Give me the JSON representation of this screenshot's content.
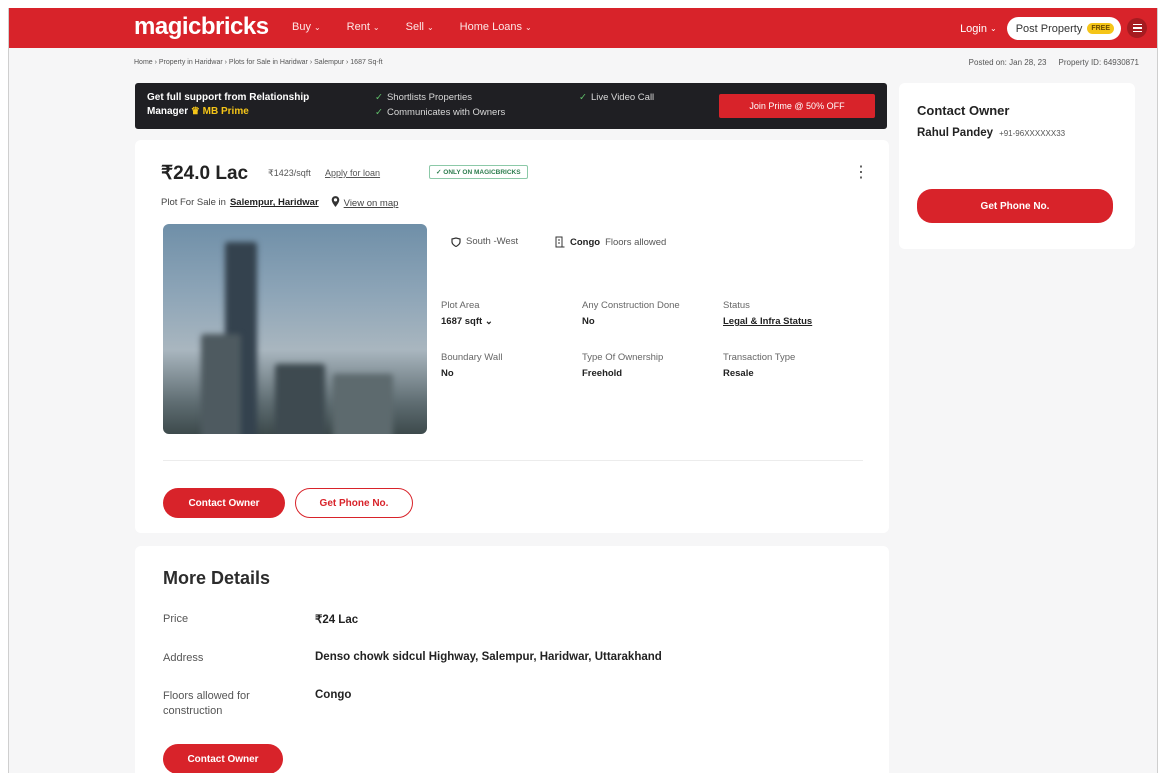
{
  "header": {
    "logo": "magicbricks",
    "nav": [
      {
        "label": "Buy"
      },
      {
        "label": "Rent"
      },
      {
        "label": "Sell"
      },
      {
        "label": "Home Loans"
      }
    ],
    "login_label": "Login",
    "post_property_label": "Post Property",
    "post_property_badge": "FREE",
    "menu_icon": "hamburger-icon"
  },
  "breadcrumb": "Home › Property in Haridwar › Plots for Sale in Haridwar › Salempur › 1687 Sq-ft",
  "posted_on": "Posted on: Jan 28, 23",
  "property_id": "Property ID: 64930871",
  "prime_banner": {
    "title_line1": "Get full support from Relationship",
    "title_line2_prefix": "Manager",
    "title_line2_brand": "MB Prime",
    "features": [
      "Shortlists Properties",
      "Communicates with Owners",
      "Live Video Call"
    ],
    "cta": "Join Prime @ 50% OFF"
  },
  "listing": {
    "price": "₹24.0 Lac",
    "price_per_sqft": "₹1423/sqft",
    "apply_loan": "Apply for loan",
    "only_badge": "ONLY ON MAGICBRICKS",
    "subtitle_prefix": "Plot For Sale in",
    "location": "Salempur, Haridwar",
    "view_map": "View on map",
    "facing": "South -West",
    "floors_value": "Congo",
    "floors_suffix": "Floors allowed",
    "attributes": [
      {
        "label": "Plot Area",
        "value": "1687 sqft"
      },
      {
        "label": "Any Construction Done",
        "value": "No"
      },
      {
        "label": "Status",
        "value": "Legal & Infra Status"
      },
      {
        "label": "Boundary Wall",
        "value": "No"
      },
      {
        "label": "Type Of Ownership",
        "value": "Freehold"
      },
      {
        "label": "Transaction Type",
        "value": "Resale"
      }
    ],
    "contact_owner_btn": "Contact Owner",
    "get_phone_btn": "Get Phone No."
  },
  "more_details": {
    "title": "More Details",
    "rows": [
      {
        "label": "Price",
        "value": "₹24 Lac"
      },
      {
        "label": "Address",
        "value": "Denso chowk sidcul Highway, Salempur, Haridwar, Uttarakhand"
      },
      {
        "label": "Floors allowed for construction",
        "value": "Congo"
      }
    ],
    "contact_owner_btn": "Contact Owner"
  },
  "contact_card": {
    "title": "Contact Owner",
    "name": "Rahul Pandey",
    "phone": "+91-96XXXXXX33",
    "button": "Get Phone No."
  },
  "colors": {
    "brand_red": "#d8232a",
    "banner_dark": "#1f1f23",
    "prime_gold": "#f5c518"
  }
}
